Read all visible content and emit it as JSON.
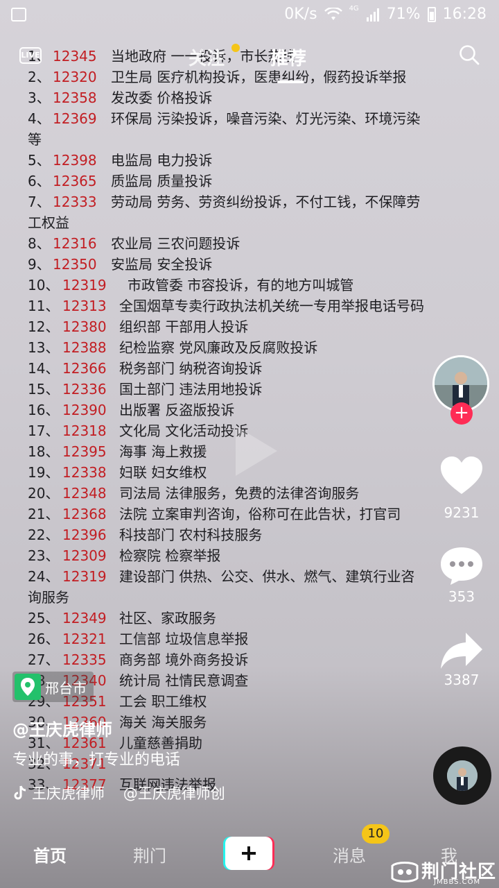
{
  "status_bar": {
    "speed": "0K/s",
    "network": "4G",
    "battery": "71%",
    "time": "16:28"
  },
  "top_nav": {
    "live_label": "LIVE",
    "tab_follow": "关注",
    "tab_recommend": "推荐"
  },
  "video_list": [
    {
      "no": "1、",
      "code": "12345",
      "desc": "当地政府 一一投诉，市长热线"
    },
    {
      "no": "2、",
      "code": "12320",
      "desc": "卫生局 医疗机构投诉，医患纠纷，假药投诉举报"
    },
    {
      "no": "3、",
      "code": "12358",
      "desc": "发改委 价格投诉"
    },
    {
      "no": "4、",
      "code": "12369",
      "desc": "环保局 污染投诉，噪音污染、灯光污染、环境污染"
    },
    {
      "no": "5、",
      "code": "12398",
      "desc": "电监局 电力投诉"
    },
    {
      "no": "6、",
      "code": "12365",
      "desc": "质监局 质量投诉"
    },
    {
      "no": "7、",
      "code": "12333",
      "desc": "劳动局 劳务、劳资纠纷投诉，不付工钱，不保障劳"
    },
    {
      "no": "8、",
      "code": "12316",
      "desc": "农业局 三农问题投诉"
    },
    {
      "no": "9、",
      "code": "12350",
      "desc": "安监局 安全投诉"
    },
    {
      "no": "10、",
      "code": "12319",
      "desc": "市政管委 市容投诉，有的地方叫城管"
    },
    {
      "no": "11、",
      "code": "12313",
      "desc": "全国烟草专卖行政执法机关统一专用举报电话号码"
    },
    {
      "no": "12、",
      "code": "12380",
      "desc": "组织部 干部用人投诉"
    },
    {
      "no": "13、",
      "code": "12388",
      "desc": "纪检监察 党风廉政及反腐败投诉"
    },
    {
      "no": "14、",
      "code": "12366",
      "desc": "税务部门 纳税咨询投诉"
    },
    {
      "no": "15、",
      "code": "12336",
      "desc": "国土部门 违法用地投诉"
    },
    {
      "no": "16、",
      "code": "12390",
      "desc": "出版署 反盗版投诉"
    },
    {
      "no": "17、",
      "code": "12318",
      "desc": "文化局 文化活动投诉"
    },
    {
      "no": "18、",
      "code": "12395",
      "desc": "海事 海上救援"
    },
    {
      "no": "19、",
      "code": "12338",
      "desc": "妇联 妇女维权"
    },
    {
      "no": "20、",
      "code": "12348",
      "desc": "司法局 法律服务，免费的法律咨询服务"
    },
    {
      "no": "21、",
      "code": "12368",
      "desc": "法院 立案审判咨询，俗称可在此告状，打官司"
    },
    {
      "no": "22、",
      "code": "12396",
      "desc": "科技部门 农村科技服务"
    },
    {
      "no": "23、",
      "code": "12309",
      "desc": "检察院 检察举报"
    },
    {
      "no": "24、",
      "code": "12319",
      "desc": "建设部门 供热、公交、供水、燃气、建筑行业咨"
    },
    {
      "no": "25、",
      "code": "12349",
      "desc": "社区、家政服务"
    },
    {
      "no": "26、",
      "code": "12321",
      "desc": "工信部 垃圾信息举报"
    },
    {
      "no": "27、",
      "code": "12335",
      "desc": "商务部 境外商务投诉"
    },
    {
      "no": "28、",
      "code": "12340",
      "desc": "统计局 社情民意调查"
    },
    {
      "no": "29、",
      "code": "12351",
      "desc": "工会 职工维权"
    },
    {
      "no": "30、",
      "code": "12360",
      "desc": "海关 海关服务"
    },
    {
      "no": "31、",
      "code": "12361",
      "desc": "儿童慈善捐助"
    },
    {
      "no": "32、",
      "code": "12371",
      "desc": ""
    },
    {
      "no": "33、",
      "code": "12377",
      "desc": "互联网违法举报"
    }
  ],
  "video_continuations": {
    "row4": "等",
    "row7": "工权益",
    "row24": "询服务"
  },
  "actions": {
    "likes": "9231",
    "comments": "353",
    "shares": "3387"
  },
  "info": {
    "location": "邢台市",
    "author": "@王庆虎律师",
    "caption": "专业的事，打专业的电话",
    "music": "王庆虎律师    @王庆虎律师创"
  },
  "bottom_nav": {
    "home": "首页",
    "hot": "荆门",
    "messages": "消息",
    "me": "我",
    "message_badge": "10"
  },
  "watermark": {
    "name": "荆门社区",
    "site": "JMBBS.COM"
  },
  "colors": {
    "code_red": "#c21d22",
    "accent_pink": "#fe2c55",
    "badge_yellow": "#f5c518",
    "location_green": "#23c16b"
  }
}
